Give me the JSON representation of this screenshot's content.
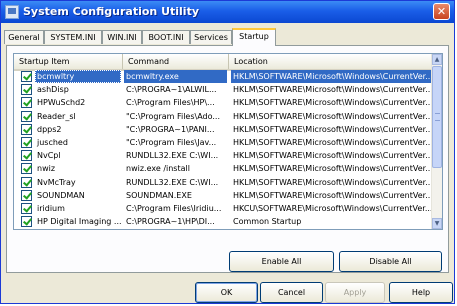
{
  "window": {
    "title": "System Configuration Utility",
    "close_glyph": "✕"
  },
  "tabs": [
    {
      "label": "General"
    },
    {
      "label": "SYSTEM.INI"
    },
    {
      "label": "WIN.INI"
    },
    {
      "label": "BOOT.INI"
    },
    {
      "label": "Services"
    },
    {
      "label": "Startup"
    }
  ],
  "list": {
    "columns": [
      "Startup Item",
      "Command",
      "Location"
    ],
    "rows": [
      {
        "item": "bcmwltry",
        "command": "bcmwltry.exe",
        "location": "HKLM\\SOFTWARE\\Microsoft\\Windows\\CurrentVer...",
        "checked": true
      },
      {
        "item": "ashDisp",
        "command": "C:\\PROGRA~1\\ALWIL...",
        "location": "HKLM\\SOFTWARE\\Microsoft\\Windows\\CurrentVer...",
        "checked": true
      },
      {
        "item": "HPWuSchd2",
        "command": "C:\\Program Files\\HP\\...",
        "location": "HKLM\\SOFTWARE\\Microsoft\\Windows\\CurrentVer...",
        "checked": true
      },
      {
        "item": "Reader_sl",
        "command": "\"C:\\Program Files\\Ado...",
        "location": "HKLM\\SOFTWARE\\Microsoft\\Windows\\CurrentVer...",
        "checked": true
      },
      {
        "item": "dpps2",
        "command": "\"C:\\PROGRA~1\\PANI...",
        "location": "HKLM\\SOFTWARE\\Microsoft\\Windows\\CurrentVer...",
        "checked": true
      },
      {
        "item": "jusched",
        "command": "\"C:\\Program Files\\Jav...",
        "location": "HKLM\\SOFTWARE\\Microsoft\\Windows\\CurrentVer...",
        "checked": true
      },
      {
        "item": "NvCpl",
        "command": "RUNDLL32.EXE C:\\WI...",
        "location": "HKLM\\SOFTWARE\\Microsoft\\Windows\\CurrentVer...",
        "checked": true
      },
      {
        "item": "nwiz",
        "command": "nwiz.exe /install",
        "location": "HKLM\\SOFTWARE\\Microsoft\\Windows\\CurrentVer...",
        "checked": true
      },
      {
        "item": "NvMcTray",
        "command": "RUNDLL32.EXE C:\\WI...",
        "location": "HKLM\\SOFTWARE\\Microsoft\\Windows\\CurrentVer...",
        "checked": true
      },
      {
        "item": "SOUNDMAN",
        "command": "SOUNDMAN.EXE",
        "location": "HKLM\\SOFTWARE\\Microsoft\\Windows\\CurrentVer...",
        "checked": true
      },
      {
        "item": "iridium",
        "command": "C:\\Program Files\\Iridiu...",
        "location": "HKCU\\SOFTWARE\\Microsoft\\Windows\\CurrentVer...",
        "checked": true
      },
      {
        "item": "HP Digital Imaging ...",
        "command": "C:\\PROGRA~1\\HP\\DI...",
        "location": "Common Startup",
        "checked": true
      }
    ],
    "scroll_up": "▲",
    "scroll_down": "▼",
    "scroll_left": "◄",
    "scroll_right": "►"
  },
  "panel_buttons": {
    "enable_all": "Enable All",
    "disable_all": "Disable All"
  },
  "dialog_buttons": {
    "ok": "OK",
    "cancel": "Cancel",
    "apply": "Apply",
    "help": "Help"
  }
}
